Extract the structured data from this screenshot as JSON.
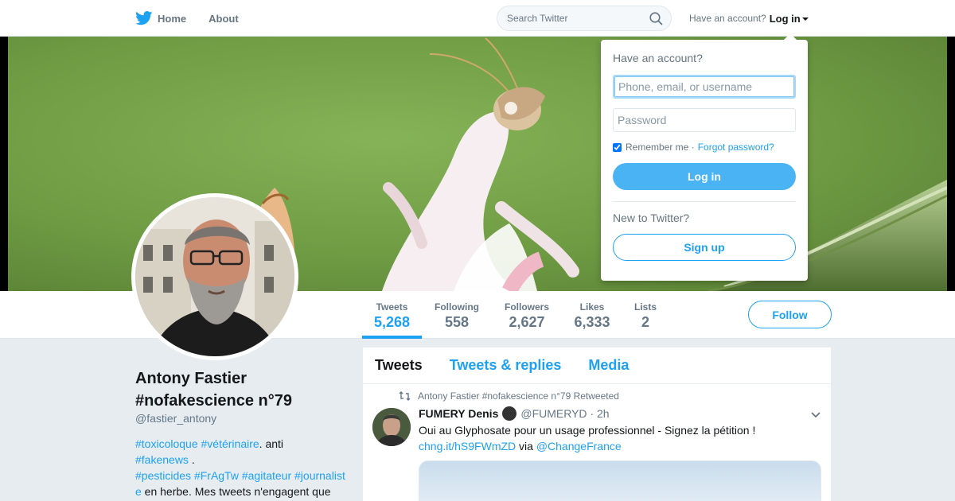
{
  "nav": {
    "home_label": "Home",
    "about_label": "About",
    "search_placeholder": "Search Twitter",
    "have_account": "Have an account?",
    "login_label": "Log in"
  },
  "stats": [
    {
      "label": "Tweets",
      "value": "5,268"
    },
    {
      "label": "Following",
      "value": "558"
    },
    {
      "label": "Followers",
      "value": "2,627"
    },
    {
      "label": "Likes",
      "value": "6,333"
    },
    {
      "label": "Lists",
      "value": "2"
    }
  ],
  "follow_label": "Follow",
  "profile": {
    "name": "Antony Fastier #nofakescience n°79",
    "handle": "@fastier_antony",
    "bio": {
      "tag1": "#toxicoloque",
      "tag2": "#vétérinaire",
      "text1": ". anti",
      "tag3": "#fakenews",
      "text2": " .",
      "tag4": "#pesticides",
      "tag5": "#FrAgTw",
      "tag6": "#agitateur",
      "tag7": "#journaliste",
      "text3": " en herbe. Mes tweets n'engagent que"
    }
  },
  "timeline": {
    "tabs": [
      "Tweets",
      "Tweets & replies",
      "Media"
    ],
    "tweet": {
      "retweet_context": "Antony Fastier #nofakescience n°79 Retweeted",
      "name": "FUMERY Denis",
      "handle": "@FUMERYD",
      "time": "· 2h",
      "text": "Oui au Glyphosate pour un usage professionnel - Signez la pétition !",
      "link": "chng.it/hS9FWmZD",
      "via": " via ",
      "mention": "@ChangeFrance"
    }
  },
  "login_dropdown": {
    "title": "Have an account?",
    "username_placeholder": "Phone, email, or username",
    "password_placeholder": "Password",
    "remember_label": "Remember me ·",
    "remember_checked": true,
    "forgot_label": "Forgot password?",
    "login_button": "Log in",
    "new_label": "New to Twitter?",
    "signup_button": "Sign up"
  },
  "colors": {
    "accent": "#1da1f2",
    "login_button": "#4ab3f4",
    "background": "#e6ecf0"
  },
  "icons": [
    "twitter-bird-icon",
    "home-icon",
    "search-icon",
    "retweet-icon",
    "chevron-down-icon",
    "verified-badge-icon"
  ]
}
